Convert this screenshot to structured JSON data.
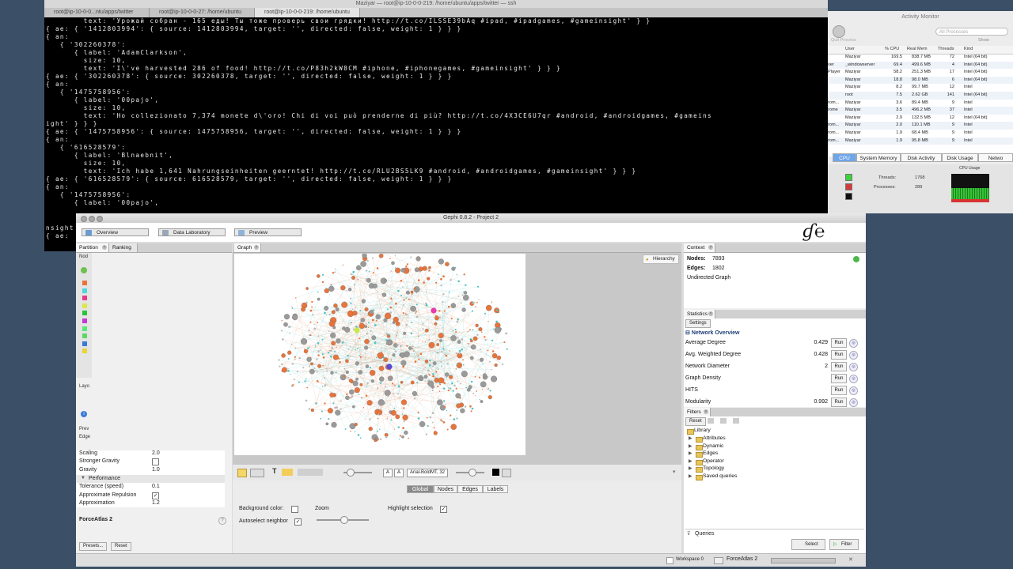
{
  "terminal": {
    "title": "Maziyar — root@ip-10-0-0-219: /home/ubuntu/apps/twitter — ssh",
    "tabs": [
      "root@ip-10-0-0...ntu/apps/twitter",
      "root@ip-10-0-0-27: /home/ubuntu",
      "root@ip-10-0-0-219: /home/ubuntu"
    ],
    "lines": [
      "        text: 'Урожай собран - 165 еды! Ты тоже проверь свои грядки! http://t.co/ILSSE39bAq #ipad, #ipadgames, #gameinsight' } }",
      "{ ae: { '1412803994': { source: 1412803994, target: '', directed: false, weight: 1 } } }",
      "{ an:",
      "   { '302260378':",
      "      { label: 'AdamClarkson',",
      "        size: 10,",
      "        text: 'I\\'ve harvested 286 of food! http://t.co/P83h2kW8CM #iphone, #iphonegames, #gameinsight' } } }",
      "{ ae: { '302260378': { source: 302260378, target: '', directed: false, weight: 1 } } }",
      "{ an:",
      "   { '1475758956':",
      "      { label: '00pajo',",
      "        size: 10,",
      "        text: 'Ho collezionato 7,374 monete d\\'oro! Chi di voi può prenderne di più? http://t.co/4X3CE6U7qr #android, #androidgames, #gameins",
      "ight' } } }",
      "{ ae: { '1475758956': { source: 1475758956, target: '', directed: false, weight: 1 } } }",
      "{ an:",
      "   { '616528579':",
      "      { label: 'Blnaebnit',",
      "        size: 10,",
      "        text: 'Ich habe 1,641 Nahrungseinheiten geerntet! http://t.co/RLU2BS5LK9 #android, #androidgames, #gameinsight' } } }",
      "{ ae: { '616528579': { source: 616528579, target: '', directed: false, weight: 1 } } }",
      "{ an:",
      "   { '1475758956':",
      "      { label: '00pajo',",
      "nsight",
      "{ ae:"
    ]
  },
  "activity_monitor": {
    "title": "Activity Monitor",
    "search_placeholder": "All Processes",
    "show_label": "Show",
    "quit_label": "Quit Process",
    "columns": [
      "User",
      "% CPU",
      "Real Mem",
      "Threads",
      "Kind"
    ],
    "rows": [
      {
        "name": "",
        "user": "Maziyar",
        "cpu": "169.5",
        "mem": "838.7 MB",
        "threads": "72",
        "kind": "Intel (64 bit)"
      },
      {
        "name": "ver",
        "user": "_windowserver",
        "cpu": "69.4",
        "mem": "499.6 MB",
        "threads": "4",
        "kind": "Intel (64 bit)"
      },
      {
        "name": "Player",
        "user": "Maziyar",
        "cpu": "58.2",
        "mem": "251.3 MB",
        "threads": "17",
        "kind": "Intel (64 bit)"
      },
      {
        "name": "",
        "user": "Maziyar",
        "cpu": "18.8",
        "mem": "98.0 MB",
        "threads": "6",
        "kind": "Intel (64 bit)"
      },
      {
        "name": "",
        "user": "Maziyar",
        "cpu": "8.2",
        "mem": "99.7 MB",
        "threads": "12",
        "kind": "Intel"
      },
      {
        "name": "",
        "user": "root",
        "cpu": "7.5",
        "mem": "2.62 GB",
        "threads": "141",
        "kind": "Intel (64 bit)"
      },
      {
        "name": "rom...",
        "user": "Maziyar",
        "cpu": "3.6",
        "mem": "89.4 MB",
        "threads": "9",
        "kind": "Intel"
      },
      {
        "name": "rome",
        "user": "Maziyar",
        "cpu": "3.5",
        "mem": "496.2 MB",
        "threads": "37",
        "kind": "Intel"
      },
      {
        "name": "",
        "user": "Maziyar",
        "cpu": "2.9",
        "mem": "132.5 MB",
        "threads": "12",
        "kind": "Intel (64 bit)"
      },
      {
        "name": "rom...",
        "user": "Maziyar",
        "cpu": "2.0",
        "mem": "110.1 MB",
        "threads": "9",
        "kind": "Intel"
      },
      {
        "name": "rom...",
        "user": "Maziyar",
        "cpu": "1.9",
        "mem": "68.4 MB",
        "threads": "9",
        "kind": "Intel"
      },
      {
        "name": "rom...",
        "user": "Maziyar",
        "cpu": "1.9",
        "mem": "95.8 MB",
        "threads": "9",
        "kind": "Intel"
      }
    ],
    "tabs": [
      "CPU",
      "System Memory",
      "Disk Activity",
      "Disk Usage",
      "Netwo"
    ],
    "threads_label": "Threads:",
    "threads_value": "1768",
    "processes_label": "Processes:",
    "processes_value": "289",
    "cpu_usage_label": "CPU Usage"
  },
  "gephi": {
    "title": "Gephi 0.8.2 - Project 2",
    "top_tabs": [
      "Overview",
      "Data Laboratory",
      "Preview"
    ],
    "left_tabs": [
      "Partition",
      "Ranking"
    ],
    "partition_colors": [
      "#e8743b",
      "#4fd8d8",
      "#e83a8a",
      "#d8e84a",
      "#2ac23a",
      "#c43ad8",
      "#5ae878",
      "#5ad860",
      "#3a7ad8",
      "#e8d43a"
    ],
    "layout_props": [
      {
        "label": "Scaling",
        "value": "2.0"
      },
      {
        "label": "Stronger Gravity",
        "value": ""
      },
      {
        "label": "Gravity",
        "value": "1.0"
      },
      {
        "label": "Tolerance (speed)",
        "value": "0.1"
      },
      {
        "label": "Approximate Repulsion",
        "value": ""
      },
      {
        "label": "Approximation",
        "value": "1.2"
      }
    ],
    "performance_label": "Performance",
    "layout_name": "ForceAtlas 2",
    "presets_label": "Presets...",
    "reset_label": "Reset",
    "graph_tab": "Graph",
    "hierarchy_label": "Hierarchy",
    "font_label": "Arial-BoldMT, 32",
    "bottom_tabs": [
      "Global",
      "Nodes",
      "Edges",
      "Labels"
    ],
    "background_color_label": "Background color:",
    "zoom_label": "Zoom",
    "highlight_label": "Highlight selection",
    "autoselect_label": "Autoselect neighbor",
    "context": {
      "tab": "Context",
      "nodes_label": "Nodes:",
      "nodes_value": "7893",
      "edges_label": "Edges:",
      "edges_value": "1802",
      "graph_type": "Undirected Graph"
    },
    "statistics": {
      "tab": "Statistics",
      "settings": "Settings",
      "section": "Network Overview",
      "run_label": "Run",
      "rows": [
        {
          "label": "Average Degree",
          "value": "0.429"
        },
        {
          "label": "Avg. Weighted Degree",
          "value": "0.428"
        },
        {
          "label": "Network Diameter",
          "value": "2"
        },
        {
          "label": "Graph Density",
          "value": ""
        },
        {
          "label": "HITS",
          "value": ""
        },
        {
          "label": "Modularity",
          "value": "0.992"
        }
      ]
    },
    "filters": {
      "tab": "Filters",
      "reset": "Reset",
      "library": "Library",
      "items": [
        "Attributes",
        "Dynamic",
        "Edges",
        "Operator",
        "Topology",
        "Saved queries"
      ],
      "queries": "Queries",
      "select_label": "Select",
      "filter_label": "Filter"
    },
    "status": {
      "workspace": "Workspace 0",
      "layout_running": "ForceAtlas 2"
    }
  }
}
